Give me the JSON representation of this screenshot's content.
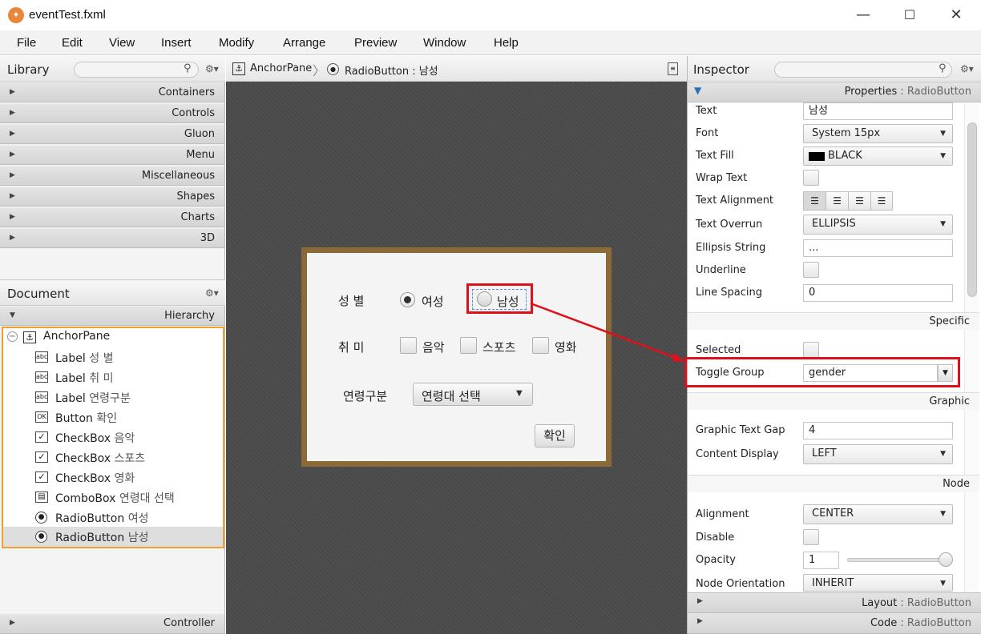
{
  "window": {
    "title": "eventTest.fxml",
    "minimize": "—",
    "maximize": "☐",
    "close": "✕"
  },
  "menu": [
    "File",
    "Edit",
    "View",
    "Insert",
    "Modify",
    "Arrange",
    "Preview",
    "Window",
    "Help"
  ],
  "library": {
    "title": "Library",
    "categories": [
      "Containers",
      "Controls",
      "Gluon",
      "Menu",
      "Miscellaneous",
      "Shapes",
      "Charts",
      "3D"
    ]
  },
  "document": {
    "title": "Document",
    "hierarchy_label": "Hierarchy",
    "controller_label": "Controller",
    "tree": [
      {
        "type": "AnchorPane",
        "text": "",
        "icon": "anchorpane-icon"
      },
      {
        "type": "Label",
        "text": "성 별",
        "icon": "label-icon"
      },
      {
        "type": "Label",
        "text": "취 미",
        "icon": "label-icon"
      },
      {
        "type": "Label",
        "text": "연령구분",
        "icon": "label-icon"
      },
      {
        "type": "Button",
        "text": "확인",
        "icon": "button-icon"
      },
      {
        "type": "CheckBox",
        "text": "음악",
        "icon": "checkbox-icon"
      },
      {
        "type": "CheckBox",
        "text": "스포츠",
        "icon": "checkbox-icon"
      },
      {
        "type": "CheckBox",
        "text": "영화",
        "icon": "checkbox-icon"
      },
      {
        "type": "ComboBox",
        "text": "연령대 선택",
        "icon": "combobox-icon"
      },
      {
        "type": "RadioButton",
        "text": "여성",
        "icon": "radiobutton-icon"
      },
      {
        "type": "RadioButton",
        "text": "남성",
        "icon": "radiobutton-icon",
        "selected": true
      }
    ]
  },
  "breadcrumb": {
    "root": "AnchorPane",
    "current": "RadioButton : 남성"
  },
  "form": {
    "gender_label": "성 별",
    "radio_female": "여성",
    "radio_male": "남성",
    "hobby_label": "취 미",
    "check_music": "음악",
    "check_sports": "스포츠",
    "check_movie": "영화",
    "age_label": "연령구분",
    "age_combo": "연령대 선택",
    "ok_button": "확인"
  },
  "inspector": {
    "title": "Inspector",
    "properties_header": {
      "name": "Properties",
      "suffix": " : RadioButton"
    },
    "props": {
      "text_label": "Text",
      "text_value": "남성",
      "font_label": "Font",
      "font_value": "System 15px",
      "textfill_label": "Text Fill",
      "textfill_value": "BLACK",
      "wrap_label": "Wrap Text",
      "align_label": "Text Alignment",
      "overrun_label": "Text Overrun",
      "overrun_value": "ELLIPSIS",
      "ellipsis_label": "Ellipsis String",
      "ellipsis_value": "...",
      "underline_label": "Underline",
      "linespacing_label": "Line Spacing",
      "linespacing_value": "0"
    },
    "specific": {
      "header": "Specific",
      "selected_label": "Selected",
      "togglegroup_label": "Toggle Group",
      "togglegroup_value": "gender"
    },
    "graphic": {
      "header": "Graphic",
      "gap_label": "Graphic Text Gap",
      "gap_value": "4",
      "display_label": "Content Display",
      "display_value": "LEFT"
    },
    "node": {
      "header": "Node",
      "alignment_label": "Alignment",
      "alignment_value": "CENTER",
      "disable_label": "Disable",
      "opacity_label": "Opacity",
      "opacity_value": "1",
      "orientation_label": "Node Orientation",
      "orientation_value": "INHERIT"
    },
    "layout_header": {
      "name": "Layout",
      "suffix": " : RadioButton"
    },
    "code_header": {
      "name": "Code",
      "suffix": " : RadioButton"
    }
  },
  "colors": {
    "annotation": "#e0101a",
    "selection": "#f0a030",
    "form_border": "#8b6a3a"
  }
}
